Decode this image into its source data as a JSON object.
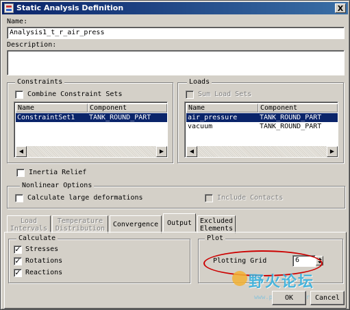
{
  "window": {
    "title": "Static Analysis Definition",
    "close_glyph": "X"
  },
  "name": {
    "label": "Name:",
    "value": "Analysis1_t_r_air_press"
  },
  "description": {
    "label": "Description:",
    "value": ""
  },
  "constraints": {
    "group_title": "Constraints",
    "combine_label": "Combine Constraint Sets",
    "columns": [
      "Name",
      "Component"
    ],
    "rows": [
      {
        "name": "ConstraintSet1",
        "component": "TANK_ROUND_PART",
        "selected": true
      }
    ]
  },
  "loads": {
    "group_title": "Loads",
    "sum_label": "Sum Load Sets",
    "columns": [
      "Name",
      "Component"
    ],
    "rows": [
      {
        "name": "air_pressure",
        "component": "TANK_ROUND_PART",
        "selected": true
      },
      {
        "name": "vacuum",
        "component": "TANK_ROUND_PART",
        "selected": false
      }
    ]
  },
  "inertia_relief": {
    "label": "Inertia Relief",
    "checked": false
  },
  "nonlinear": {
    "group_title": "Nonlinear Options",
    "large_deformations_label": "Calculate large deformations",
    "include_contacts_label": "Include Contacts"
  },
  "tabs": [
    {
      "label": "Load\nIntervals",
      "disabled": true
    },
    {
      "label": "Temperature\nDistribution",
      "disabled": true
    },
    {
      "label": "Convergence",
      "disabled": false
    },
    {
      "label": "Output",
      "disabled": false,
      "active": true
    },
    {
      "label": "Excluded\nElements",
      "disabled": false
    }
  ],
  "calculate": {
    "group_title": "Calculate",
    "items": [
      {
        "label": "Stresses",
        "checked": true
      },
      {
        "label": "Rotations",
        "checked": true
      },
      {
        "label": "Reactions",
        "checked": true
      }
    ]
  },
  "plot": {
    "group_title": "Plot",
    "plotting_grid_label": "Plotting Grid",
    "plotting_grid_value": "6"
  },
  "buttons": {
    "ok": "OK",
    "cancel": "Cancel"
  },
  "watermark": {
    "text": "野火论坛",
    "url": "www.proewildfire.cn"
  },
  "colors": {
    "title_bar": "#0a246a",
    "selection": "#0a246a",
    "highlight_ellipse": "#cc0000",
    "dialog_bg": "#d4d0c8"
  }
}
